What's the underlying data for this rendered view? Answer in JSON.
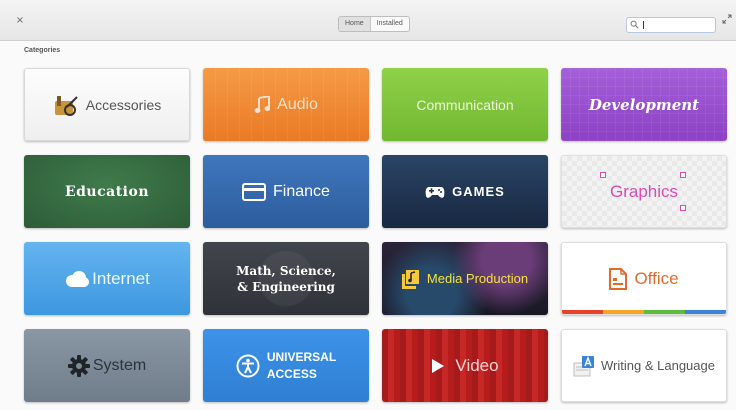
{
  "window": {
    "close_glyph": "×",
    "tabs": [
      {
        "label": "Home",
        "active": true
      },
      {
        "label": "Installed",
        "active": false
      }
    ],
    "search": {
      "value": "",
      "placeholder": ""
    }
  },
  "section_label": "Categories",
  "categories": [
    {
      "label": "Accessories",
      "icon": "toolbox-icon"
    },
    {
      "label": "Audio",
      "icon": "music-note-icon"
    },
    {
      "label": "Communication",
      "icon": ""
    },
    {
      "label": "Development",
      "icon": ""
    },
    {
      "label": "Education",
      "icon": ""
    },
    {
      "label": "Finance",
      "icon": "credit-card-icon"
    },
    {
      "label": "GAMES",
      "icon": "gamepad-icon"
    },
    {
      "label": "Graphics",
      "icon": "selection-handles-icon"
    },
    {
      "label": "Internet",
      "icon": "cloud-icon"
    },
    {
      "label": "Math, Science, & Engineering",
      "line1": "Math, Science,",
      "line2": "& Engineering",
      "icon": ""
    },
    {
      "label": "Media Production",
      "icon": "media-production-icon"
    },
    {
      "label": "Office",
      "icon": "document-icon"
    },
    {
      "label": "System",
      "icon": "gear-icon"
    },
    {
      "label": "UNIVERSAL ACCESS",
      "line1": "UNIVERSAL",
      "line2": "ACCESS",
      "icon": "accessibility-icon"
    },
    {
      "label": "Video",
      "icon": "play-icon"
    },
    {
      "label": "Writing & Language",
      "icon": "writing-icon"
    }
  ]
}
